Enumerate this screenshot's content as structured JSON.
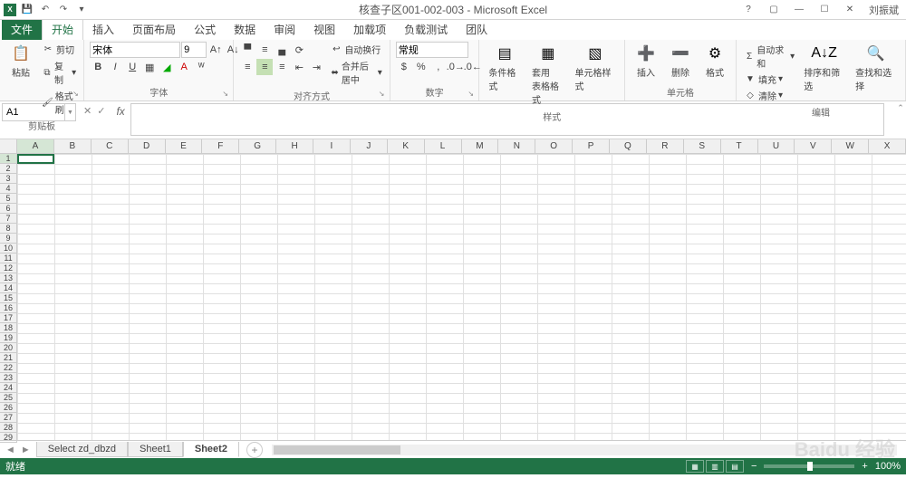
{
  "title": "核查子区001-002-003 - Microsoft Excel",
  "user": "刘振斌",
  "qat": {
    "save": "💾",
    "undo": "↶",
    "redo": "↷"
  },
  "tabs": {
    "file": "文件",
    "home": "开始",
    "insert": "插入",
    "layout": "页面布局",
    "formula": "公式",
    "data": "数据",
    "review": "审阅",
    "view": "视图",
    "addin": "加载项",
    "loadtest": "负载测试",
    "team": "团队"
  },
  "ribbon": {
    "clipboard": {
      "paste": "粘贴",
      "cut": "剪切",
      "copy": "复制",
      "painter": "格式刷",
      "label": "剪贴板"
    },
    "font": {
      "name": "宋体",
      "size": "9",
      "label": "字体"
    },
    "align": {
      "wrap": "自动换行",
      "merge": "合并后居中",
      "label": "对齐方式"
    },
    "number": {
      "format": "常规",
      "label": "数字"
    },
    "styles": {
      "cond": "条件格式",
      "table": "套用\n表格格式",
      "cell": "单元格样式",
      "label": "样式"
    },
    "cells": {
      "insert": "插入",
      "delete": "删除",
      "format": "格式",
      "label": "单元格"
    },
    "editing": {
      "sum": "自动求和",
      "fill": "填充",
      "clear": "清除",
      "sort": "排序和筛选",
      "find": "查找和选择",
      "label": "编辑"
    }
  },
  "namebox": "A1",
  "columns": [
    "A",
    "B",
    "C",
    "D",
    "E",
    "F",
    "G",
    "H",
    "I",
    "J",
    "K",
    "L",
    "M",
    "N",
    "O",
    "P",
    "Q",
    "R",
    "S",
    "T",
    "U",
    "V",
    "W",
    "X"
  ],
  "rows": [
    "1",
    "2",
    "3",
    "4",
    "5",
    "6",
    "7",
    "8",
    "9",
    "10",
    "11",
    "12",
    "13",
    "14",
    "15",
    "16",
    "17",
    "18",
    "19",
    "20",
    "21",
    "22",
    "23",
    "24",
    "25",
    "26",
    "27",
    "28",
    "29"
  ],
  "sheets": {
    "s1": "Select zd_dbzd",
    "s2": "Sheet1",
    "s3": "Sheet2"
  },
  "status": {
    "ready": "就绪",
    "zoom": "100%"
  },
  "watermark": "Baidu 经验"
}
